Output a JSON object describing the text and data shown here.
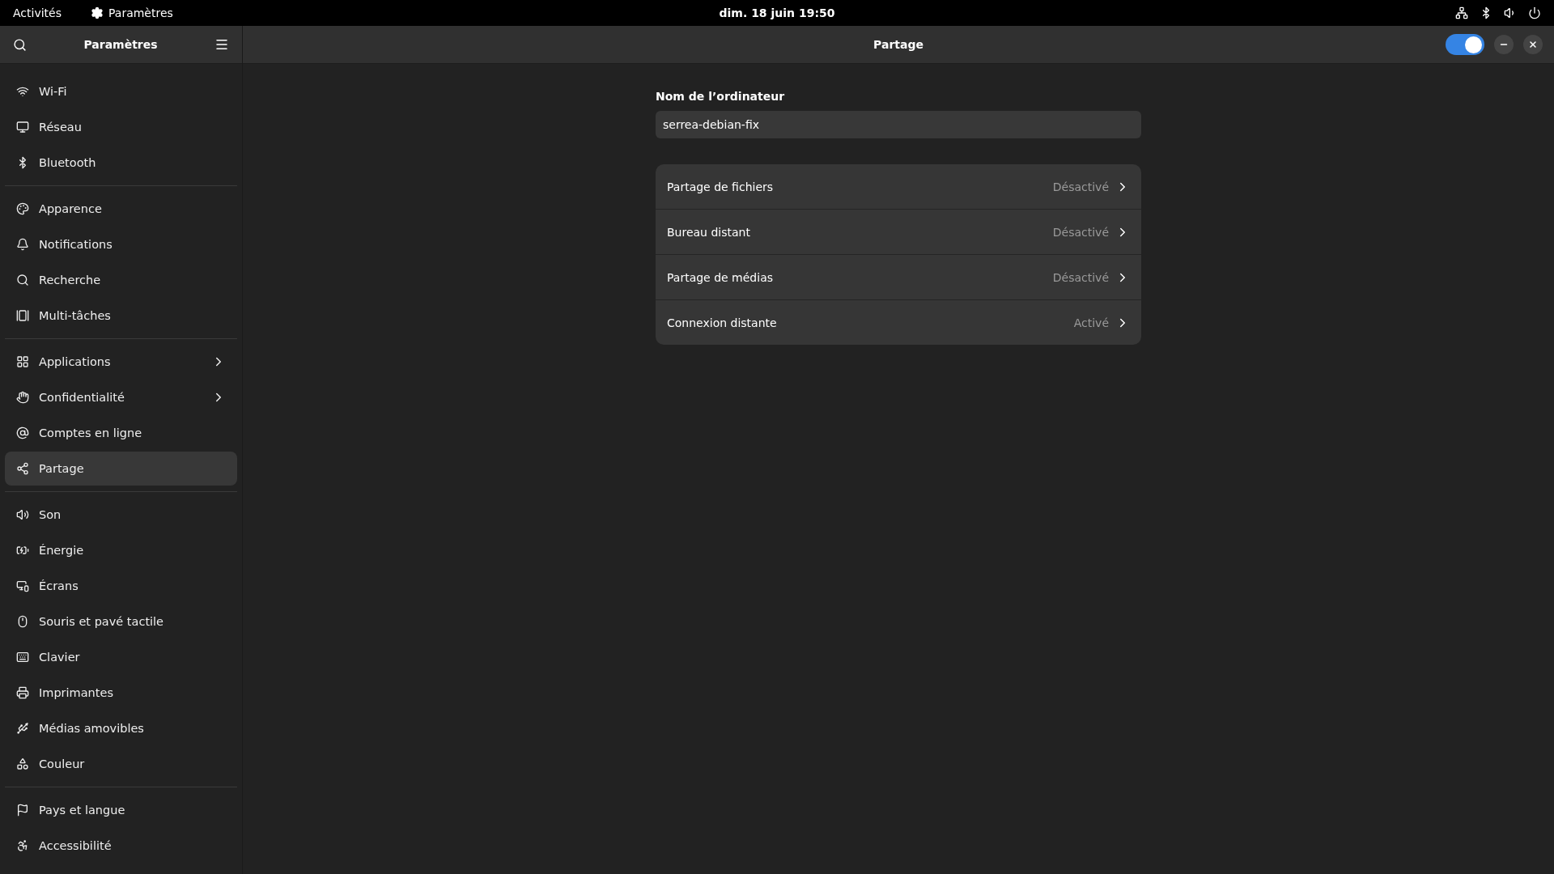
{
  "top_bar": {
    "activities": "Activités",
    "app": "Paramètres",
    "clock": "dim. 18 juin  19:50"
  },
  "sidebar": {
    "title": "Paramètres",
    "groups": [
      [
        {
          "label": "Wi-Fi",
          "selected": false,
          "submenu": false
        },
        {
          "label": "Réseau",
          "selected": false,
          "submenu": false
        },
        {
          "label": "Bluetooth",
          "selected": false,
          "submenu": false
        }
      ],
      [
        {
          "label": "Apparence",
          "selected": false,
          "submenu": false
        },
        {
          "label": "Notifications",
          "selected": false,
          "submenu": false
        },
        {
          "label": "Recherche",
          "selected": false,
          "submenu": false
        },
        {
          "label": "Multi-tâches",
          "selected": false,
          "submenu": false
        }
      ],
      [
        {
          "label": "Applications",
          "selected": false,
          "submenu": true
        },
        {
          "label": "Confidentialité",
          "selected": false,
          "submenu": true
        },
        {
          "label": "Comptes en ligne",
          "selected": false,
          "submenu": false
        },
        {
          "label": "Partage",
          "selected": true,
          "submenu": false
        }
      ],
      [
        {
          "label": "Son",
          "selected": false,
          "submenu": false
        },
        {
          "label": "Énergie",
          "selected": false,
          "submenu": false
        },
        {
          "label": "Écrans",
          "selected": false,
          "submenu": false
        },
        {
          "label": "Souris et pavé tactile",
          "selected": false,
          "submenu": false
        },
        {
          "label": "Clavier",
          "selected": false,
          "submenu": false
        },
        {
          "label": "Imprimantes",
          "selected": false,
          "submenu": false
        },
        {
          "label": "Médias amovibles",
          "selected": false,
          "submenu": false
        },
        {
          "label": "Couleur",
          "selected": false,
          "submenu": false
        }
      ],
      [
        {
          "label": "Pays et langue",
          "selected": false,
          "submenu": false
        },
        {
          "label": "Accessibilité",
          "selected": false,
          "submenu": false
        }
      ]
    ]
  },
  "header": {
    "title": "Partage",
    "sharing_switch": {
      "on": true
    }
  },
  "computer_name": {
    "label": "Nom de l’ordinateur",
    "value": "serrea-debian-fix"
  },
  "services": [
    {
      "name": "Partage de fichiers",
      "status": "Désactivé"
    },
    {
      "name": "Bureau distant",
      "status": "Désactivé"
    },
    {
      "name": "Partage de médias",
      "status": "Désactivé"
    },
    {
      "name": "Connexion distante",
      "status": "Activé"
    }
  ]
}
